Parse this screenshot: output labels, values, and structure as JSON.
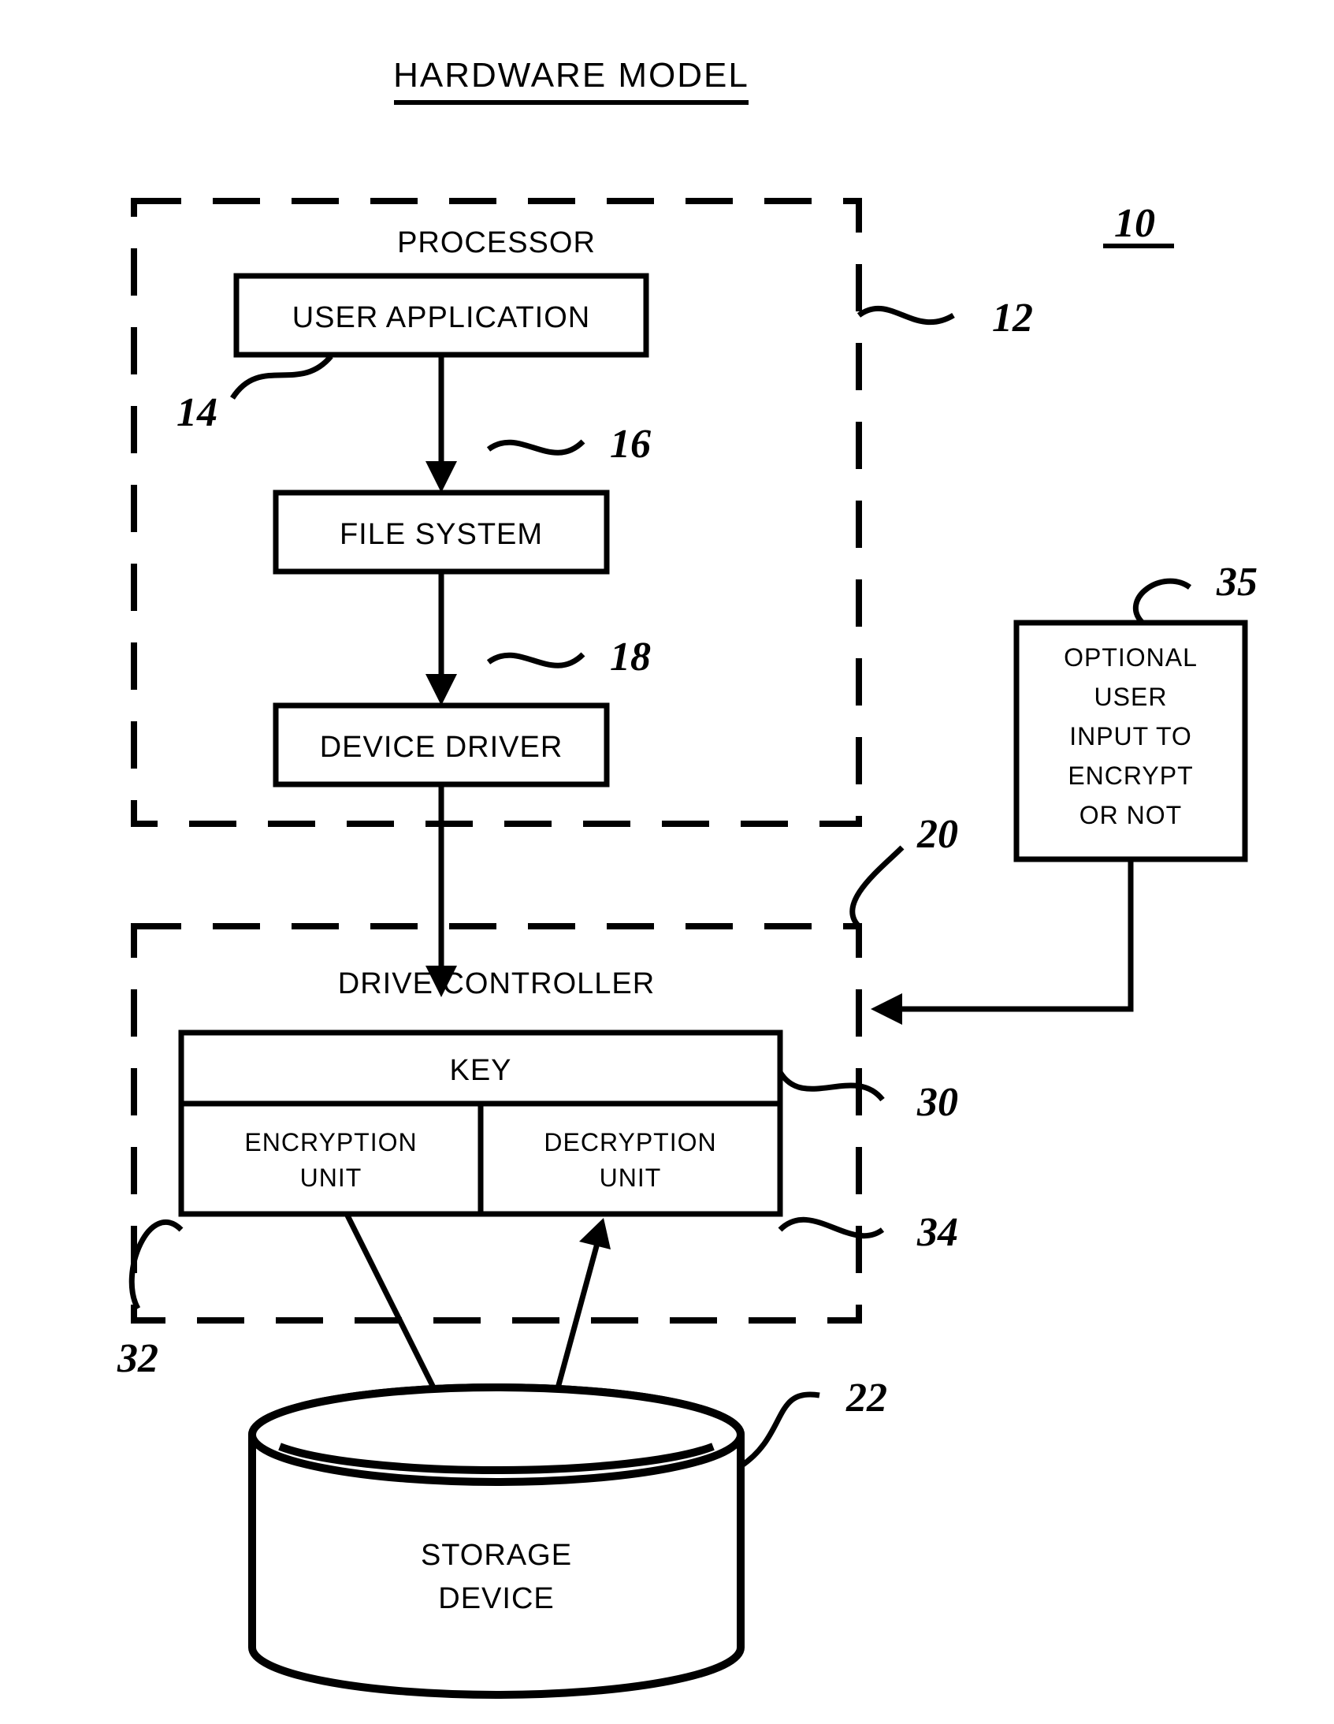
{
  "title": "HARDWARE MODEL",
  "processor": {
    "label": "PROCESSOR",
    "user_application": "USER APPLICATION",
    "file_system": "FILE SYSTEM",
    "device_driver": "DEVICE DRIVER"
  },
  "drive_controller": {
    "label": "DRIVE CONTROLLER",
    "key": "KEY",
    "encryption_unit_l1": "ENCRYPTION",
    "encryption_unit_l2": "UNIT",
    "decryption_unit_l1": "DECRYPTION",
    "decryption_unit_l2": "UNIT"
  },
  "optional_input": {
    "l1": "OPTIONAL",
    "l2": "USER",
    "l3": "INPUT TO",
    "l4": "ENCRYPT",
    "l5": "OR NOT"
  },
  "storage": {
    "l1": "STORAGE",
    "l2": "DEVICE"
  },
  "refs": {
    "r10": "10",
    "r12": "12",
    "r14": "14",
    "r16": "16",
    "r18": "18",
    "r20": "20",
    "r22": "22",
    "r30": "30",
    "r32": "32",
    "r34": "34",
    "r35": "35"
  }
}
